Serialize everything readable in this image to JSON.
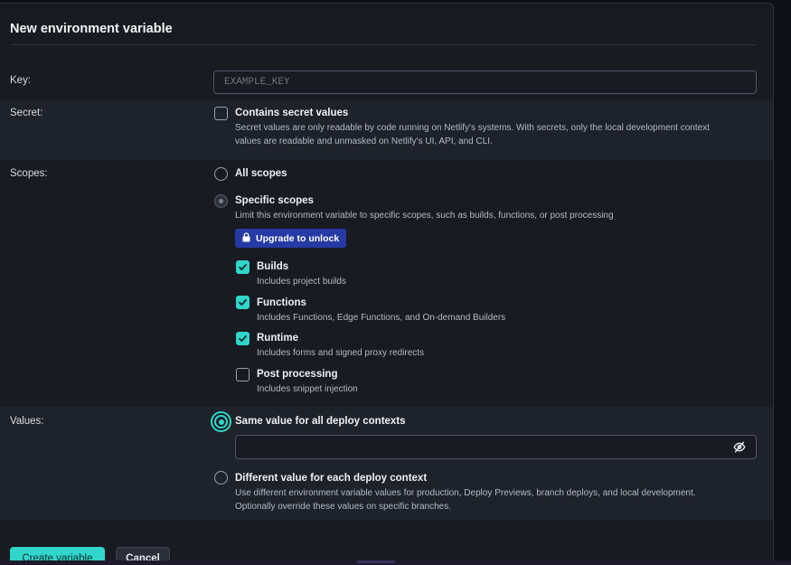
{
  "header": {
    "title": "New environment variable"
  },
  "key": {
    "label": "Key:",
    "placeholder": "EXAMPLE_KEY"
  },
  "secret": {
    "label": "Secret:",
    "option_label": "Contains secret values",
    "checked": false,
    "description_line1": "Secret values are only readable by code running on Netlify's systems. With secrets, only the local development context",
    "description_line2": "values are readable and unmasked on Netlify's UI, API, and CLI."
  },
  "scopes": {
    "label": "Scopes:",
    "all_label": "All scopes",
    "specific_label": "Specific scopes",
    "specific_description": "Limit this environment variable to specific scopes, such as builds, functions, or post processing",
    "upgrade_button": "Upgrade to unlock",
    "items": [
      {
        "label": "Builds",
        "description": "Includes project builds",
        "checked": true
      },
      {
        "label": "Functions",
        "description": "Includes Functions, Edge Functions, and On-demand Builders",
        "checked": true
      },
      {
        "label": "Runtime",
        "description": "Includes forms and signed proxy redirects",
        "checked": true
      },
      {
        "label": "Post processing",
        "description": "Includes snippet injection",
        "checked": false
      }
    ]
  },
  "values": {
    "label": "Values:",
    "same_label": "Same value for all deploy contexts",
    "same_selected": true,
    "value_input": "",
    "different_label": "Different value for each deploy context",
    "different_description_line1": "Use different environment variable values for production, Deploy Previews, branch deploys, and local development.",
    "different_description_line2": "Optionally override these values on specific branches."
  },
  "footer": {
    "create_button": "Create variable",
    "cancel_button": "Cancel"
  },
  "icons": {
    "lock": "lock-icon",
    "eye": "eye-slash-icon",
    "check": "check-icon"
  },
  "colors": {
    "accent": "#2fd6c9",
    "upgrade": "#263aa6",
    "background": "#181b22"
  }
}
